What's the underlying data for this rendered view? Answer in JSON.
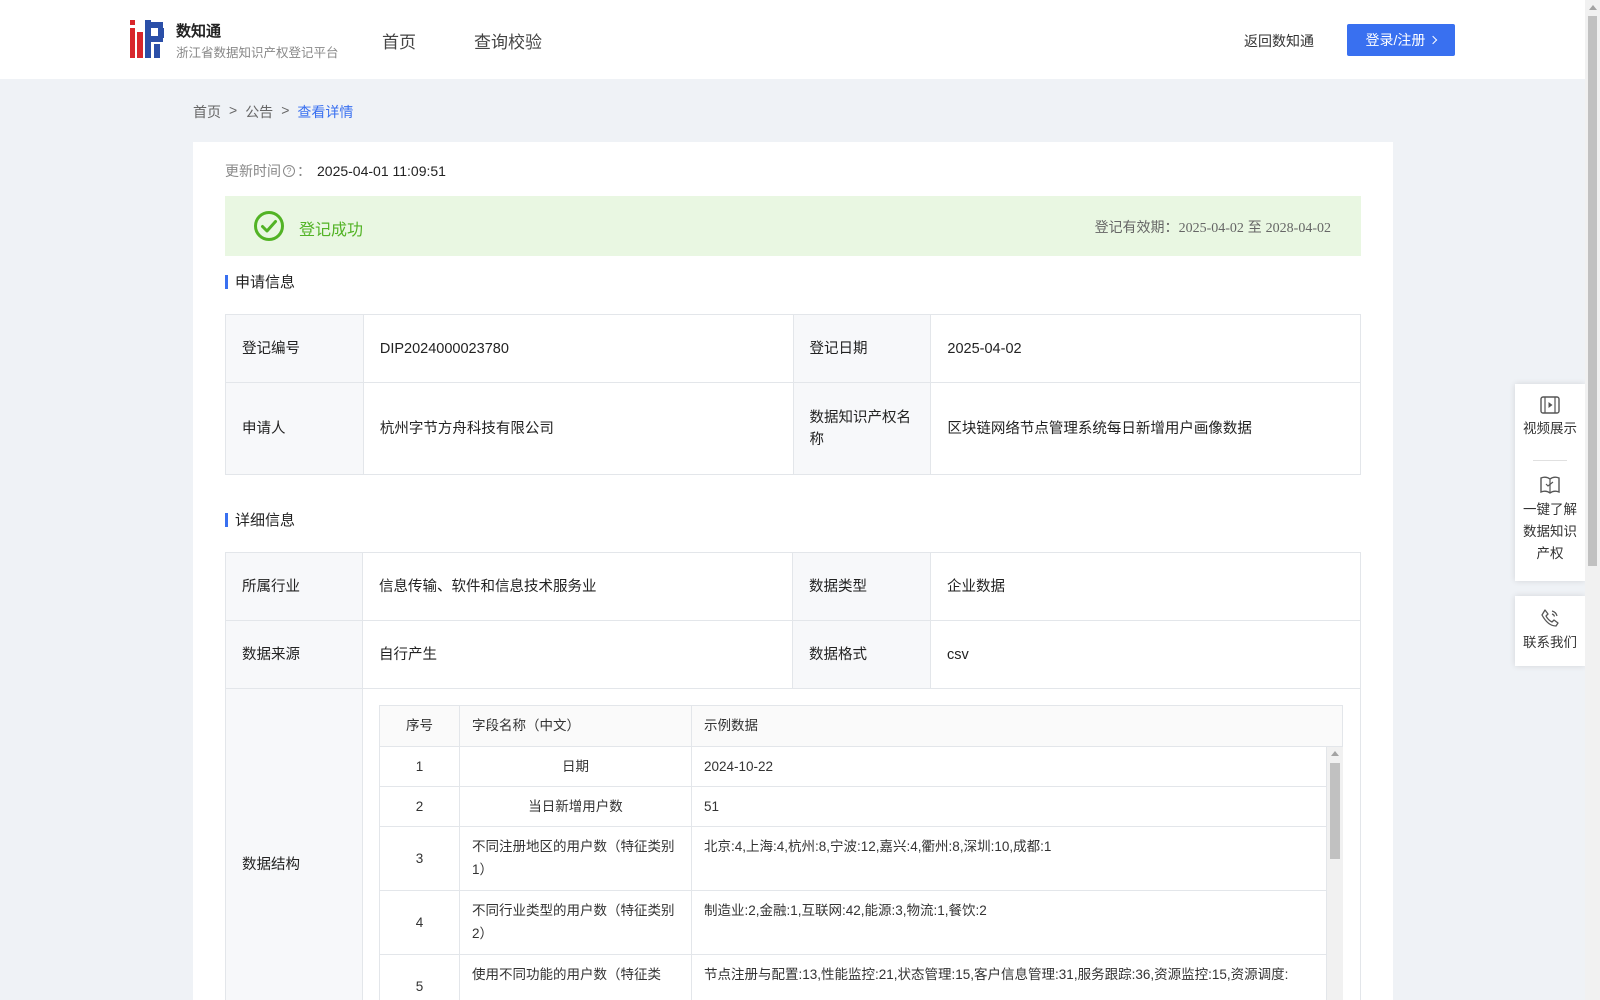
{
  "header": {
    "brand_name": "数知通",
    "brand_sub": "浙江省数据知识产权登记平台",
    "nav": [
      "首页",
      "查询校验"
    ],
    "back_link": "返回数知通",
    "login_label": "登录/注册"
  },
  "breadcrumb": [
    "首页",
    "公告",
    "查看详情"
  ],
  "update": {
    "label": "更新时间",
    "value": "2025-04-01 11:09:51"
  },
  "status": {
    "text": "登记成功",
    "validity_label": "登记有效期：",
    "validity_start": "2025-04-02",
    "validity_to": "至",
    "validity_end": "2028-04-02"
  },
  "application": {
    "title": "申请信息",
    "reg_no_label": "登记编号",
    "reg_no": "DIP2024000023780",
    "reg_date_label": "登记日期",
    "reg_date": "2025-04-02",
    "applicant_label": "申请人",
    "applicant": "杭州字节方舟科技有限公司",
    "ip_name_label": "数据知识产权名称",
    "ip_name": "区块链网络节点管理系统每日新增用户画像数据"
  },
  "detail": {
    "title": "详细信息",
    "industry_label": "所属行业",
    "industry": "信息传输、软件和信息技术服务业",
    "data_type_label": "数据类型",
    "data_type": "企业数据",
    "source_label": "数据来源",
    "source": "自行产生",
    "format_label": "数据格式",
    "format": "csv",
    "structure_label": "数据结构",
    "structure_headers": [
      "序号",
      "字段名称（中文）",
      "示例数据"
    ],
    "structure_rows": [
      {
        "idx": "1",
        "name": "日期",
        "example": "2024-10-22"
      },
      {
        "idx": "2",
        "name": "当日新增用户数",
        "example": "51"
      },
      {
        "idx": "3",
        "name": "不同注册地区的用户数（特征类别1）",
        "example": "北京:4,上海:4,杭州:8,宁波:12,嘉兴:4,衢州:8,深圳:10,成都:1"
      },
      {
        "idx": "4",
        "name": "不同行业类型的用户数（特征类别2）",
        "example": "制造业:2,金融:1,互联网:42,能源:3,物流:1,餐饮:2"
      },
      {
        "idx": "5",
        "name": "使用不同功能的用户数（特征类",
        "example": "节点注册与配置:13,性能监控:21,状态管理:15,客户信息管理:31,服务跟踪:36,资源监控:15,资源调度:"
      }
    ]
  },
  "float_panel": {
    "video": "视频展示",
    "learn": "一键了解数据知识产权",
    "contact": "联系我们"
  },
  "colors": {
    "primary": "#3970f0",
    "success": "#52b325",
    "success_bg": "#e9f7e2"
  }
}
